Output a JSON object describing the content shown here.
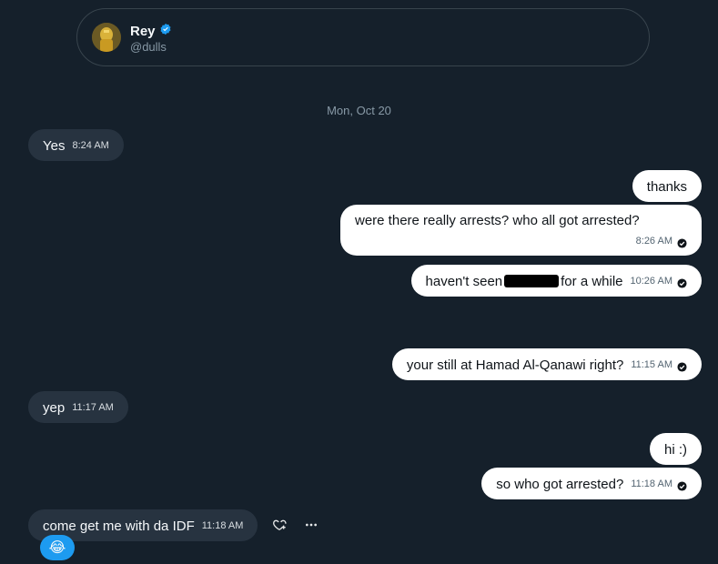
{
  "profile": {
    "name": "Rey",
    "handle": "@dulls",
    "verified_icon": "verified-badge-icon"
  },
  "date_divider": "Mon, Oct 20",
  "messages": [
    {
      "dir": "in",
      "text": "Yes",
      "time": "8:24 AM"
    },
    {
      "dir": "out",
      "text": "thanks"
    },
    {
      "dir": "out",
      "text": "were there really arrests? who all got arrested?",
      "time": "8:26 AM"
    },
    {
      "dir": "out",
      "text_before": "haven't seen",
      "text_after": "for a while",
      "time": "10:26 AM",
      "redacted": true
    },
    {
      "dir": "out",
      "text": "your still at Hamad Al-Qanawi right?",
      "time": "11:15 AM"
    },
    {
      "dir": "in",
      "text": "yep",
      "time": "11:17 AM"
    },
    {
      "dir": "out",
      "text": "hi :)"
    },
    {
      "dir": "out",
      "text": "so who got arrested?",
      "time": "11:18 AM"
    },
    {
      "dir": "in",
      "text": "come get me with da IDF",
      "time": "11:18 AM"
    }
  ],
  "reaction": {
    "emoji": "😂"
  },
  "actions": [
    "react-icon",
    "more-icon"
  ],
  "colors": {
    "background": "#15202b",
    "incoming_bubble": "#273340",
    "outgoing_bubble": "#ffffff",
    "accent": "#1d9bf0"
  }
}
